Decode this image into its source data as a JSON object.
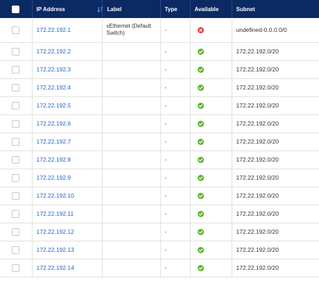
{
  "columns": {
    "ip": "IP Address",
    "label": "Label",
    "type": "Type",
    "available": "Available",
    "subnet": "Subnet"
  },
  "colors": {
    "header_bg": "#0b2a63",
    "link": "#1f63c9",
    "available_ok": "#5cb531",
    "available_err": "#e23b3b"
  },
  "rows": [
    {
      "ip": "172.22.192.1",
      "label": "vEthernet (Default Switch)",
      "type": "-",
      "available": "unavailable",
      "subnet": "undefined-0.0.0.0/0"
    },
    {
      "ip": "172.22.192.2",
      "label": "",
      "type": "-",
      "available": "available",
      "subnet": "172.22.192.0/20"
    },
    {
      "ip": "172.22.192.3",
      "label": "",
      "type": "-",
      "available": "available",
      "subnet": "172.22.192.0/20"
    },
    {
      "ip": "172.22.192.4",
      "label": "",
      "type": "-",
      "available": "available",
      "subnet": "172.22.192.0/20"
    },
    {
      "ip": "172.22.192.5",
      "label": "",
      "type": "-",
      "available": "available",
      "subnet": "172.22.192.0/20"
    },
    {
      "ip": "172.22.192.6",
      "label": "",
      "type": "-",
      "available": "available",
      "subnet": "172.22.192.0/20"
    },
    {
      "ip": "172.22.192.7",
      "label": "",
      "type": "-",
      "available": "available",
      "subnet": "172.22.192.0/20"
    },
    {
      "ip": "172.22.192.8",
      "label": "",
      "type": "-",
      "available": "available",
      "subnet": "172.22.192.0/20"
    },
    {
      "ip": "172.22.192.9",
      "label": "",
      "type": "-",
      "available": "available",
      "subnet": "172.22.192.0/20"
    },
    {
      "ip": "172.22.192.10",
      "label": "",
      "type": "-",
      "available": "available",
      "subnet": "172.22.192.0/20"
    },
    {
      "ip": "172.22.192.11",
      "label": "",
      "type": "-",
      "available": "available",
      "subnet": "172.22.192.0/20"
    },
    {
      "ip": "172.22.192.12",
      "label": "",
      "type": "-",
      "available": "available",
      "subnet": "172.22.192.0/20"
    },
    {
      "ip": "172.22.192.13",
      "label": "",
      "type": "-",
      "available": "available",
      "subnet": "172.22.192.0/20"
    },
    {
      "ip": "172.22.192.14",
      "label": "",
      "type": "-",
      "available": "available",
      "subnet": "172.22.192.0/20"
    }
  ]
}
